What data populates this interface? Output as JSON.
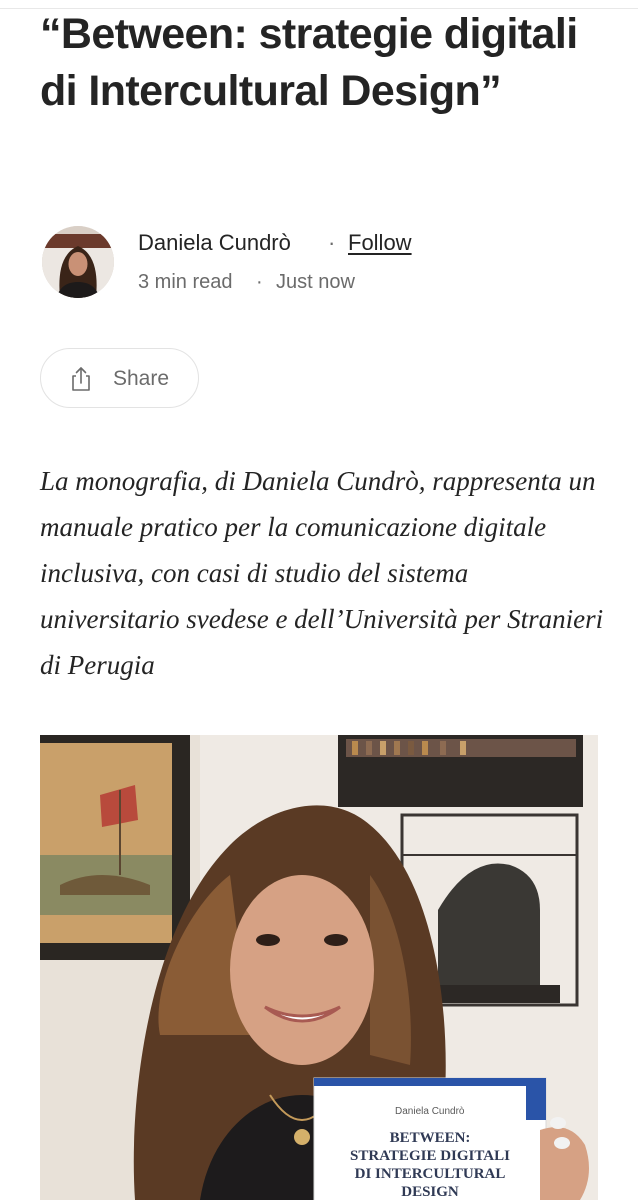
{
  "article": {
    "title": "“Between: strategie digitali di Intercultural Design”",
    "subtitle": "La monografia, di Daniela Cundrò, rappresenta un manuale pratico per la comunicazione digitale inclusiva, con casi di studio del sistema universitario svedese e dell’Università per Stranieri di Perugia"
  },
  "author": {
    "name": "Daniela Cundrò",
    "separator": "·",
    "follow_label": "Follow",
    "read_time": "3 min read",
    "published": "Just now"
  },
  "actions": {
    "share_label": "Share",
    "share_icon": "share-icon"
  },
  "image": {
    "book_cover": {
      "author": "Daniela Cundrò",
      "title_lines": [
        "BETWEEN:",
        "STRATEGIE DIGITALI",
        "DI INTERCULTURAL",
        "DESIGN"
      ]
    }
  },
  "colors": {
    "text": "#242424",
    "muted": "#6b6b6b",
    "border": "#e3e3e3",
    "background": "#ffffff"
  }
}
